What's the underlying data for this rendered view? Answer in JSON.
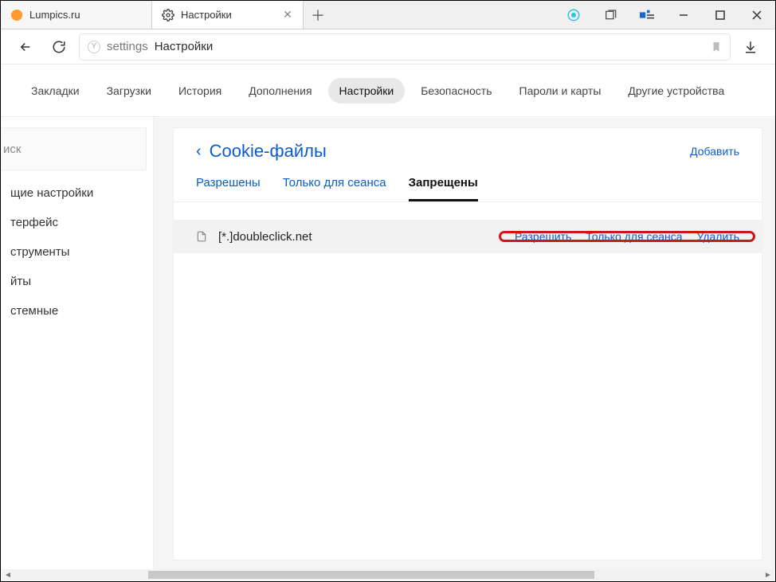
{
  "tabs": [
    {
      "title": "Lumpics.ru",
      "favicon": "orange"
    },
    {
      "title": "Настройки",
      "favicon": "gear",
      "active": true
    }
  ],
  "address": {
    "host": "settings",
    "page": "Настройки"
  },
  "topnav": {
    "items": [
      "Закладки",
      "Загрузки",
      "История",
      "Дополнения",
      "Настройки",
      "Безопасность",
      "Пароли и карты",
      "Другие устройства"
    ],
    "activeIndex": 4
  },
  "sidebar": {
    "search_placeholder": "иск",
    "items": [
      "щие настройки",
      "терфейс",
      "струменты",
      "йты",
      "стемные"
    ]
  },
  "panel": {
    "title": "Cookie-файлы",
    "add_label": "Добавить",
    "subtabs": [
      "Разрешены",
      "Только для сеанса",
      "Запрещены"
    ],
    "activeSubtab": 2,
    "row": {
      "domain": "[*.]doubleclick.net",
      "actions": [
        "Разрешить",
        "Только для сеанса",
        "Удалить"
      ]
    }
  },
  "scrollbar": {
    "thumbLeft": 168,
    "thumbWidth": 560
  }
}
